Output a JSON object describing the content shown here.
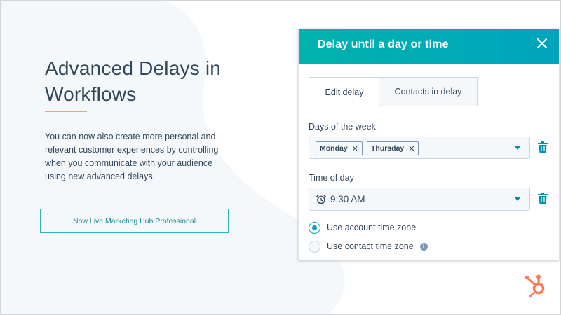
{
  "slide": {
    "title": "Advanced Delays in Workflows",
    "description": "You can now also create more personal and relevant customer experiences by controlling when you communicate with your audience using new advanced delays.",
    "cta_label": "Now Live Marketing Hub Professional"
  },
  "dialog": {
    "title": "Delay until a day or time",
    "tabs": [
      {
        "label": "Edit delay",
        "active": true
      },
      {
        "label": "Contacts in delay",
        "active": false
      }
    ],
    "days_label": "Days of the week",
    "days_selected": [
      {
        "label": "Monday"
      },
      {
        "label": "Thursday"
      }
    ],
    "chip_remove": "✕",
    "time_label": "Time of day",
    "time_value": "9:30 AM",
    "timezone_options": [
      {
        "label": "Use account time zone",
        "checked": true
      },
      {
        "label": "Use contact time zone",
        "checked": false
      }
    ],
    "info_glyph": "i"
  },
  "icons": {
    "close": "close-icon",
    "caret": "chevron-down-icon",
    "trash": "trash-icon",
    "alarm": "alarm-clock-icon",
    "info": "info-icon",
    "logo": "hubspot-sprocket-icon"
  },
  "colors": {
    "accent": "#00a4bd",
    "header_gradient_start": "#00b3ad",
    "header_gradient_end": "#00a4bd",
    "text": "#33475b",
    "rule": "#f2a088",
    "logo": "#ff7a59",
    "background_shape": "#f5f8fa"
  }
}
